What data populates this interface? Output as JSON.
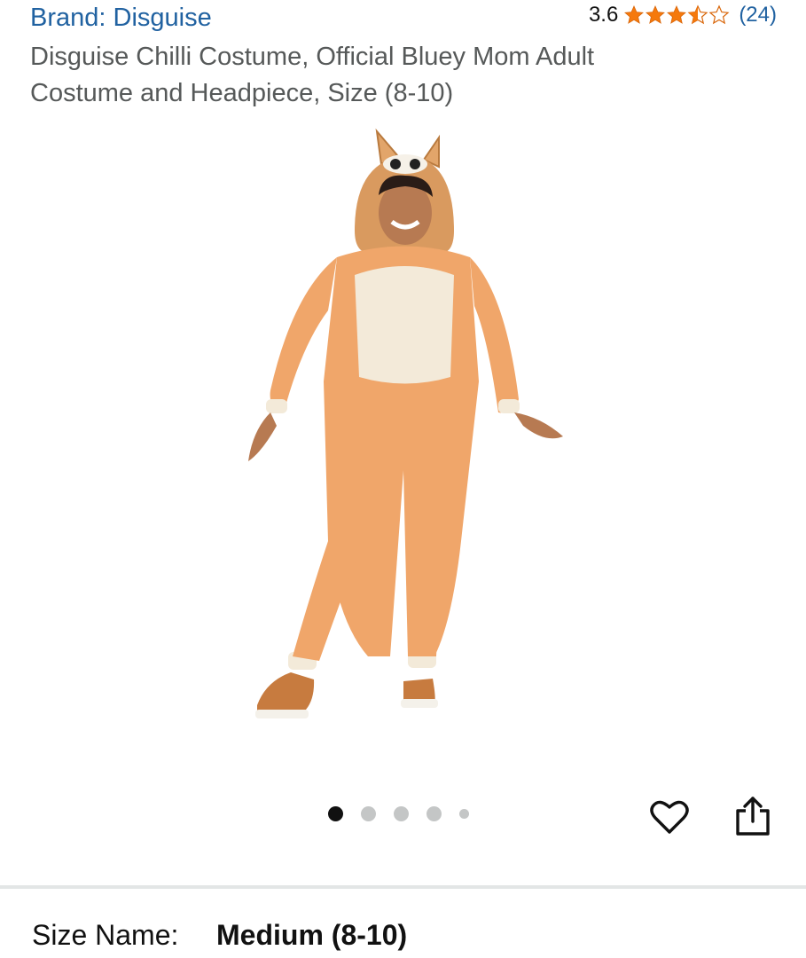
{
  "header": {
    "brand_link": "Brand: Disguise",
    "rating_score": "3.6",
    "rating_stars": 3.6,
    "rating_count": "(24)",
    "title": "Disguise Chilli Costume, Official Bluey Mom Adult Costume and Headpiece, Size (8-10)"
  },
  "colors": {
    "link": "#2162a1",
    "star": "#f5790c",
    "title": "#565959",
    "dot_active": "#111111",
    "dot_inactive": "#c4c6c6",
    "costume_orange": "#f0a66a",
    "costume_cream": "#f3ead9"
  },
  "image": {
    "icon": "product-photo-chilli-costume"
  },
  "carousel": {
    "total_dots": 5,
    "active_index": 0
  },
  "actions": {
    "wishlist_icon": "heart-icon",
    "share_icon": "share-icon"
  },
  "variation": {
    "label": "Size Name:",
    "value": "Medium (8-10)"
  }
}
